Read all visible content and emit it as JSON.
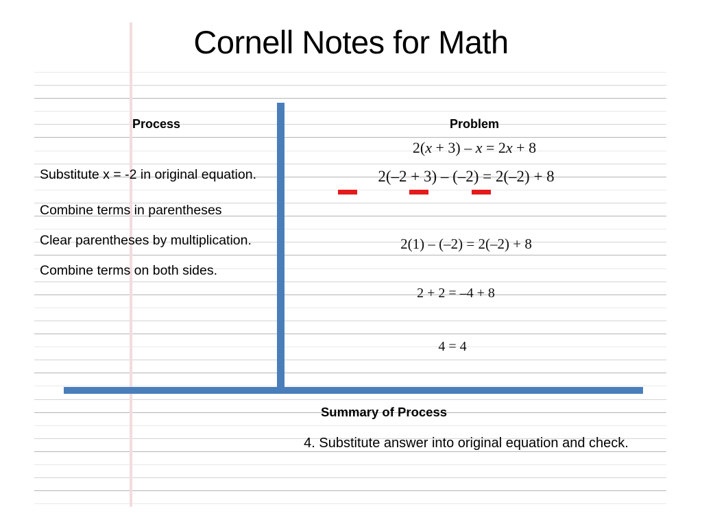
{
  "slide": {
    "title": "Cornell Notes for Math",
    "background_color": "#ffffff",
    "accent_color": "#4a7ebb",
    "margin_line_color": "#f2dcdf",
    "rule_color": "#d2d3d5",
    "highlight_color": "#e31b1b"
  },
  "columns": {
    "process_header": "Process",
    "problem_header": "Problem"
  },
  "process_steps": [
    {
      "text": "Substitute  x = -2 in original equation."
    },
    {
      "text": "Combine terms in parentheses"
    },
    {
      "text": "Clear parentheses by multiplication."
    },
    {
      "text": "Combine terms on both sides."
    }
  ],
  "equations": [
    {
      "plain": "2(x + 3) – x = 2x + 8"
    },
    {
      "plain": "2(–2 + 3) – (–2) = 2(–2) + 8"
    },
    {
      "plain": "2(1) – (–2) =  2(–2) + 8"
    },
    {
      "plain": "2 + 2 = –4 + 8"
    },
    {
      "plain": "4 = 4"
    }
  ],
  "highlight_marks": [
    {
      "label": "substituted-value-mark-1"
    },
    {
      "label": "substituted-value-mark-2"
    },
    {
      "label": "substituted-value-mark-3"
    }
  ],
  "summary": {
    "title": "Summary of Process",
    "body": "4. Substitute answer into original equation and check."
  }
}
